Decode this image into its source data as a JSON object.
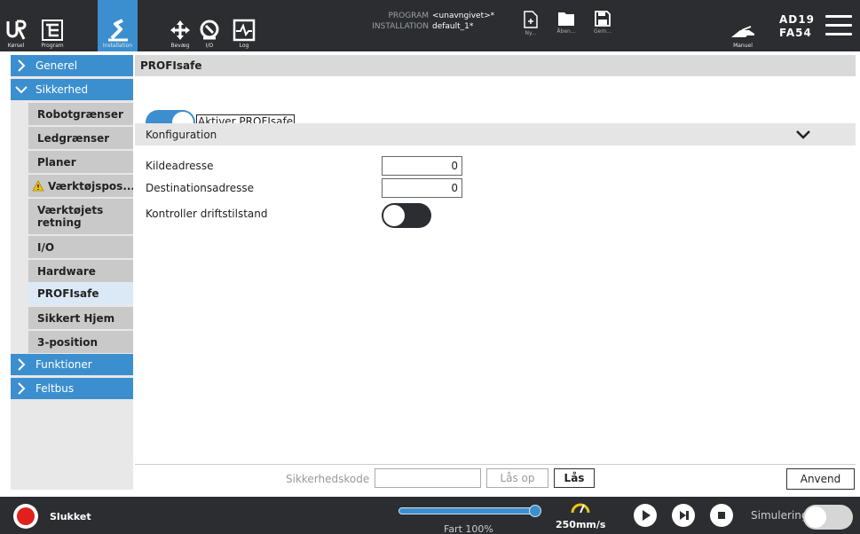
{
  "header": {
    "nav": [
      {
        "id": "run",
        "label": "Kørsel",
        "icon": "ur-logo-icon"
      },
      {
        "id": "program",
        "label": "Program",
        "icon": "program-tree-icon"
      },
      {
        "id": "installation",
        "label": "Installation",
        "icon": "installation-icon",
        "active": true
      },
      {
        "id": "move",
        "label": "Bevæg",
        "icon": "move-arrows-icon"
      },
      {
        "id": "io",
        "label": "I/O",
        "icon": "io-icon"
      },
      {
        "id": "log",
        "label": "Log",
        "icon": "log-icon"
      }
    ],
    "program_key": "PROGRAM",
    "program_value": "<unavngivet>*",
    "installation_key": "INSTALLATION",
    "installation_value": "default_1*",
    "file_buttons": [
      {
        "id": "new",
        "label": "Ny...",
        "icon": "new-file-icon"
      },
      {
        "id": "open",
        "label": "Åben...",
        "icon": "folder-icon"
      },
      {
        "id": "save",
        "label": "Gem...",
        "icon": "save-icon"
      }
    ],
    "mode_label": "Manuel",
    "robot_id_1": "AD19",
    "robot_id_2": "FA54"
  },
  "sidebar": {
    "general": "Generel",
    "safety": "Sikkerhed",
    "items": [
      {
        "id": "robot-limits",
        "label": "Robotgrænser"
      },
      {
        "id": "joint-limits",
        "label": "Ledgrænser"
      },
      {
        "id": "planes",
        "label": "Planer"
      },
      {
        "id": "tool-position",
        "label": "Værktøjspos...",
        "warning": true
      },
      {
        "id": "tool-direction",
        "label": "Værktøjets retning"
      },
      {
        "id": "io",
        "label": "I/O"
      },
      {
        "id": "hardware",
        "label": "Hardware"
      },
      {
        "id": "profisafe",
        "label": "PROFIsafe",
        "selected": true
      },
      {
        "id": "safe-home",
        "label": "Sikkert Hjem"
      },
      {
        "id": "3-position",
        "label": "3-position"
      }
    ],
    "features": "Funktioner",
    "fieldbus": "Feltbus"
  },
  "main": {
    "title": "PROFIsafe",
    "enable_label": "Aktiver PROFIsafe",
    "enable_on": true,
    "config_title": "Konfiguration",
    "source_label": "Kildeadresse",
    "source_value": "0",
    "dest_label": "Destinationsadresse",
    "dest_value": "0",
    "mode_check_label": "Kontroller driftstilstand",
    "mode_check_on": false
  },
  "footer": {
    "code_label": "Sikkerhedskode",
    "unlock": "Lås op",
    "lock": "Lås",
    "apply": "Anvend"
  },
  "bottom": {
    "status": "Slukket",
    "speed_fraction": 1.0,
    "speed_label": "Fart 100%",
    "speed_value": "250mm/s",
    "sim_label": "Simulering",
    "sim_on": false
  },
  "colors": {
    "accent": "#3c8fcf",
    "header_bg": "#2b2d30",
    "power_red": "#e0201b"
  }
}
